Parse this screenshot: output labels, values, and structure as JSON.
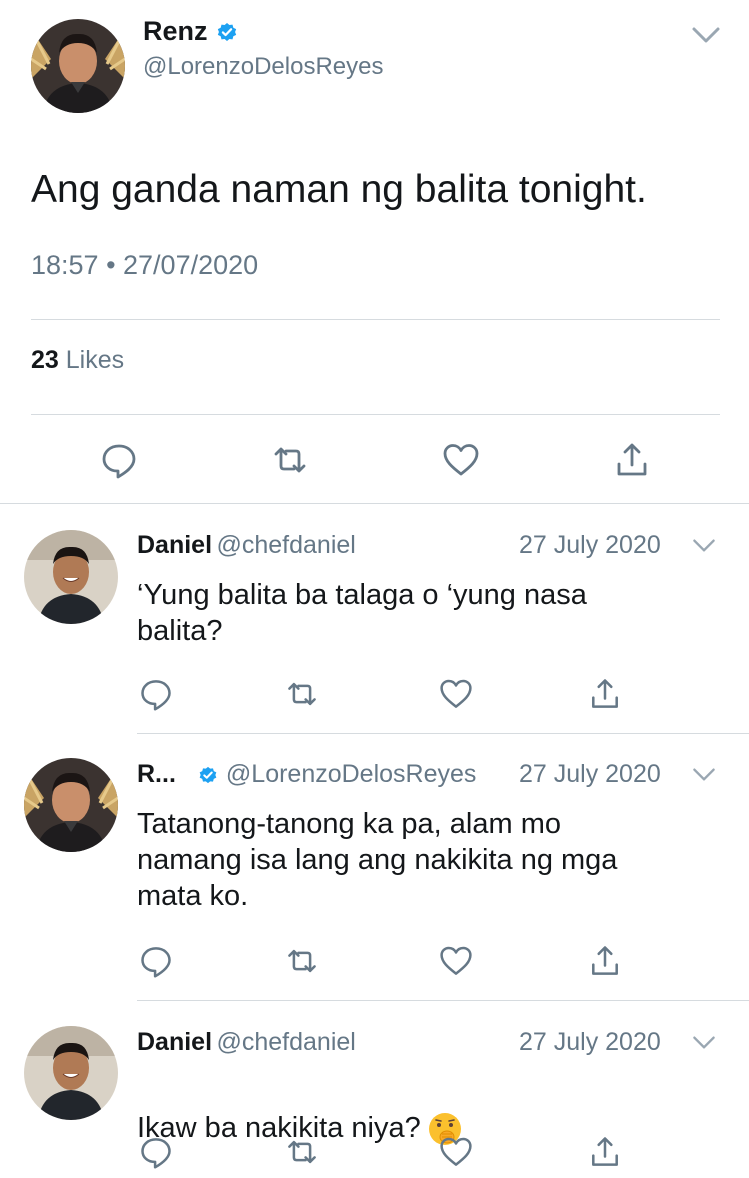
{
  "main_tweet": {
    "name": "Renz",
    "handle": "@LorenzoDelosReyes",
    "text": "Ang ganda naman ng balita tonight.",
    "time": "18:57 • 27/07/2020",
    "likes_count": "23",
    "likes_label": "Likes"
  },
  "replies": [
    {
      "name": "Daniel",
      "handle": "@chefdaniel",
      "date": "27 July 2020",
      "text": "‘Yung balita ba talaga o ‘yung nasa\nbalita?"
    },
    {
      "name": "R...",
      "handle": "@LorenzoDelosReyes",
      "date": "27 July 2020",
      "text": "Tatanong-tanong ka pa, alam mo\nnamang isa lang ang nakikita ng mga\nmata ko."
    },
    {
      "name": "Daniel",
      "handle": "@chefdaniel",
      "date": "27 July 2020",
      "text": "Ikaw ba nakikita niya?"
    }
  ],
  "colors": {
    "verified": "#1da1f2",
    "text": "#14171a",
    "secondary": "#657786",
    "divider": "#d6dbdf",
    "icon": "#657786"
  }
}
